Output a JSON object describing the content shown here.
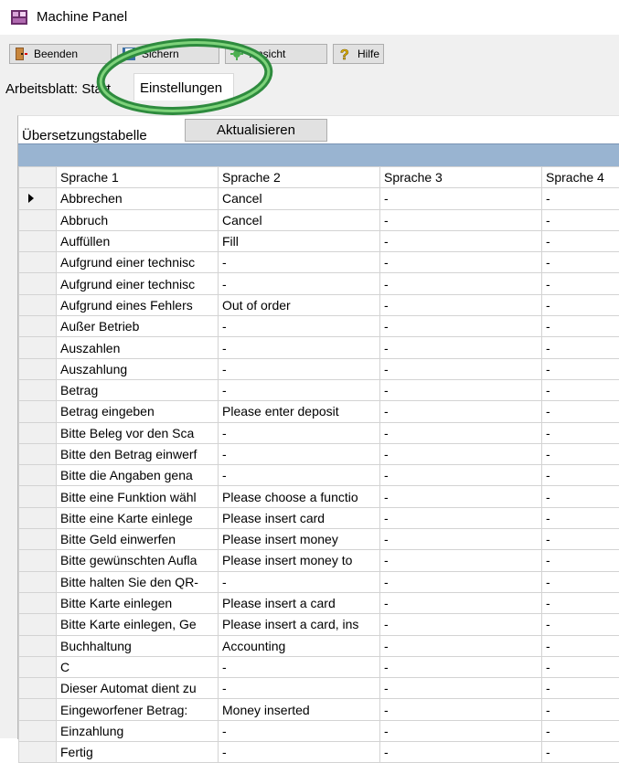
{
  "window": {
    "title": "Machine Panel"
  },
  "toolbar": {
    "buttons": [
      {
        "label": "Beenden",
        "icon": "exit-door-icon"
      },
      {
        "label": "Sichern",
        "icon": "save-icon"
      },
      {
        "label": "Ansicht",
        "icon": "view-icon"
      },
      {
        "label": "Hilfe",
        "icon": "help-icon"
      }
    ]
  },
  "tabs": [
    {
      "label": "Arbeitsblatt: Start",
      "active": false
    },
    {
      "label": "Einstellungen",
      "active": true
    }
  ],
  "panel": {
    "title": "Übersetzungstabelle",
    "refresh_label": "Aktualisieren"
  },
  "grid": {
    "columns": [
      "Sprache 1",
      "Sprache 2",
      "Sprache 3",
      "Sprache 4"
    ],
    "rows": [
      [
        "Abbrechen",
        "Cancel",
        "-",
        "-"
      ],
      [
        "Abbruch",
        "Cancel",
        "-",
        "-"
      ],
      [
        "Auffüllen",
        "Fill",
        "-",
        "-"
      ],
      [
        "Aufgrund einer technisc",
        "-",
        "-",
        "-"
      ],
      [
        "Aufgrund einer technisc",
        "-",
        "-",
        "-"
      ],
      [
        "Aufgrund eines Fehlers",
        "Out of order",
        "-",
        "-"
      ],
      [
        "Außer Betrieb",
        "-",
        "-",
        "-"
      ],
      [
        "Auszahlen",
        "-",
        "-",
        "-"
      ],
      [
        "Auszahlung",
        "-",
        "-",
        "-"
      ],
      [
        "Betrag",
        "-",
        "-",
        "-"
      ],
      [
        "Betrag eingeben",
        "Please enter deposit",
        "-",
        "-"
      ],
      [
        "Bitte Beleg vor den Sca",
        "-",
        "-",
        "-"
      ],
      [
        "Bitte den Betrag einwerf",
        "-",
        "-",
        "-"
      ],
      [
        "Bitte die Angaben gena",
        "-",
        "-",
        "-"
      ],
      [
        "Bitte eine Funktion wähl",
        "Please choose a functio",
        "-",
        "-"
      ],
      [
        "Bitte eine Karte einlege",
        "Please insert card",
        "-",
        "-"
      ],
      [
        "Bitte Geld einwerfen",
        "Please insert money",
        "-",
        "-"
      ],
      [
        "Bitte gewünschten Aufla",
        "Please insert money to",
        "-",
        "-"
      ],
      [
        "Bitte halten Sie den QR-",
        "-",
        "-",
        "-"
      ],
      [
        "Bitte Karte einlegen",
        "Please insert a card",
        "-",
        "-"
      ],
      [
        "Bitte Karte einlegen, Ge",
        "Please insert a card, ins",
        "-",
        "-"
      ],
      [
        "Buchhaltung",
        "Accounting",
        "-",
        "-"
      ],
      [
        "C",
        "-",
        "-",
        "-"
      ],
      [
        "Dieser Automat dient zu",
        "-",
        "-",
        "-"
      ],
      [
        "Eingeworfener Betrag:",
        "Money inserted",
        "-",
        "-"
      ],
      [
        "Einzahlung",
        "-",
        "-",
        "-"
      ],
      [
        "Fertig",
        "-",
        "-",
        "-"
      ]
    ],
    "current_row": 0
  },
  "colors": {
    "header_band": "#99b4d1",
    "ring": "#3fa845",
    "toolbar_bg": "#f0f0f0"
  }
}
